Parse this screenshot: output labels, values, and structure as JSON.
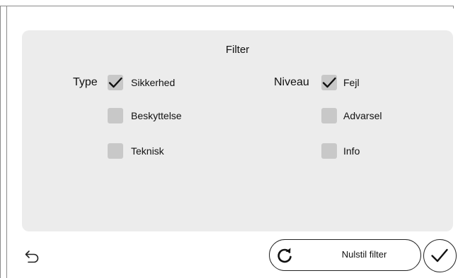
{
  "filter": {
    "title": "Filter",
    "type_group": {
      "label": "Type",
      "options": [
        {
          "label": "Sikkerhed",
          "checked": true
        },
        {
          "label": "Beskyttelse",
          "checked": false
        },
        {
          "label": "Teknisk",
          "checked": false
        }
      ]
    },
    "level_group": {
      "label": "Niveau",
      "options": [
        {
          "label": "Fejl",
          "checked": true
        },
        {
          "label": "Advarsel",
          "checked": false
        },
        {
          "label": "Info",
          "checked": false
        }
      ]
    }
  },
  "footer": {
    "back_icon": "undo-arrow-icon",
    "reset_label": "Nulstil filter",
    "reset_icon": "refresh-icon",
    "confirm_icon": "checkmark-icon"
  },
  "colors": {
    "panel": "#ececec",
    "checkbox": "#c8c8c8",
    "check_mark": "#111111",
    "border": "#8a8a8a"
  }
}
